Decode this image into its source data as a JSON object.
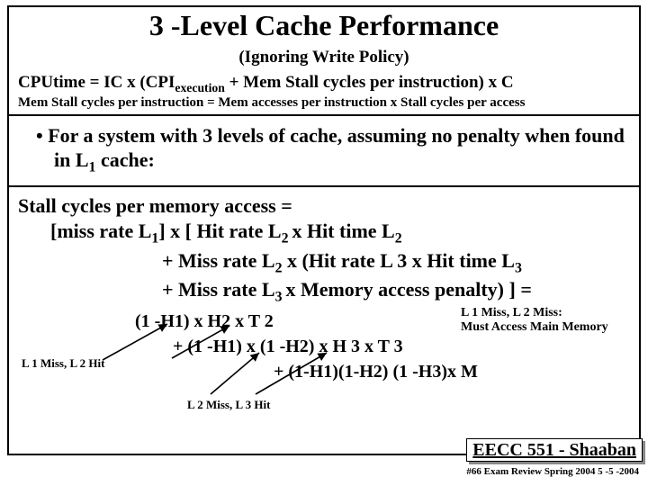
{
  "title": "3 -Level Cache Performance",
  "subtitle": "(Ignoring Write Policy)",
  "eq1": "CPUtime  =  IC x   (CPI<sub>execution</sub>  +  Mem Stall  cycles per instruction)    x   C",
  "eq2": "Mem Stall cycles per instruction =   Mem accesses per instruction  x  Stall cycles per access",
  "bullet": "For a system with 3 levels of cache, assuming no penalty when found in L<sub>1</sub> cache:",
  "stall_head": "Stall cycles per memory access =",
  "stall_l2": "[miss rate L<sub>1</sub>] x  [ Hit rate L<sub>2 </sub> x Hit time L<sub>2</sub>",
  "stall_l3": "+  Miss rate L<sub>2</sub> x  (Hit rate L 3 x Hit time L<sub>3 </sub>",
  "stall_l4": "+  Miss rate L<sub>3 </sub> x  Memory access penalty) ]  =",
  "exp_line1": "(1 -H1) x H2 x T 2",
  "exp_line2": "+    (1 -H1) x (1 -H2) x H 3 x T 3",
  "exp_line3": "+     (1-H1)(1-H2) (1 -H3)x M",
  "miss_note_l1": "L 1 Miss,  L 2 Miss:",
  "miss_note_l2": "Must Access Main Memory",
  "hit12": "L 1 Miss,  L 2  Hit",
  "hit23": "L 2 Miss,  L 3  Hit",
  "eecc": "EECC 551 - Shaaban",
  "review": "#66   Exam Review  Spring 2004  5 -5 -2004"
}
